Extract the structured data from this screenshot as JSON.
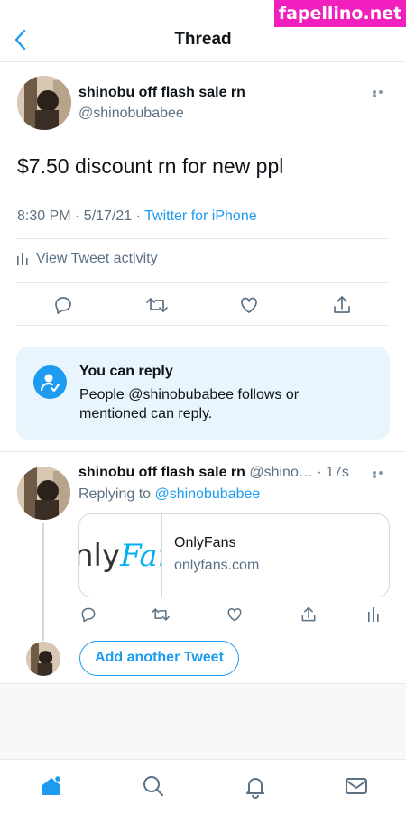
{
  "watermark": "fapellino.net",
  "header": {
    "title": "Thread"
  },
  "tweet": {
    "author_name": "shinobu off flash sale rn",
    "handle": "@shinobubabee",
    "text": "$7.50 discount rn for new ppl",
    "time": "8:30 PM · 5/17/21 · ",
    "source": "Twitter for iPhone",
    "activity": "View Tweet activity"
  },
  "reply_notice": {
    "title": "You can reply",
    "body": "People @shinobubabee follows or mentioned can reply."
  },
  "reply": {
    "author_name": "shinobu off flash sale rn",
    "handle": "@shino…",
    "time": "· 17s",
    "replying_prefix": "Replying to ",
    "replying_to": "@shinobubabee",
    "card_logo": "nly",
    "card_logo_script": "Fan",
    "card_title": "OnlyFans",
    "card_domain": "onlyfans.com"
  },
  "add_tweet": "Add another Tweet",
  "colors": {
    "accent": "#1d9bf0",
    "notice_bg": "#e8f5fd",
    "watermark": "#f21fbf"
  }
}
